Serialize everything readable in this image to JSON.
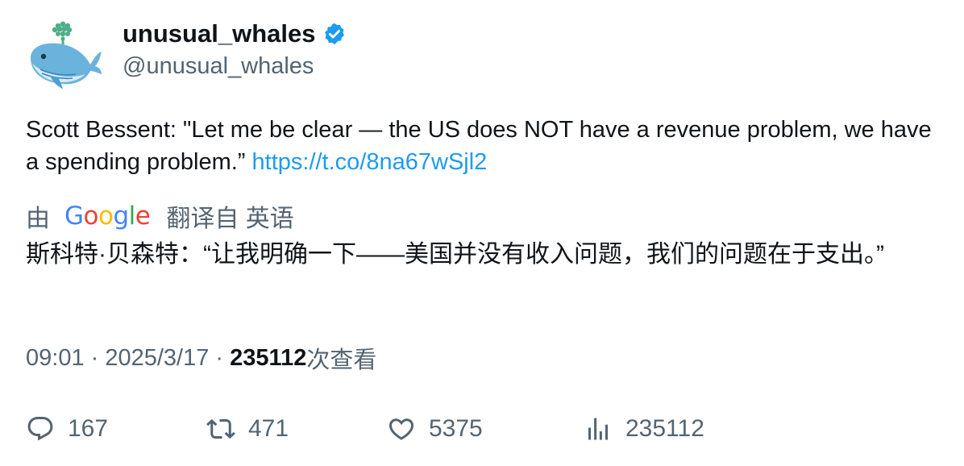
{
  "author": {
    "display_name": "unusual_whales",
    "handle": "@unusual_whales",
    "verified": true,
    "avatar_icon": "whale-logo-icon",
    "verified_icon": "verified-badge-icon"
  },
  "tweet": {
    "text": "Scott Bessent: \"Let me be clear — the US does NOT have a revenue problem, we have a spending problem.”",
    "link": "https://t.co/8na67wSjl2"
  },
  "translation": {
    "prefix": "由",
    "provider": "Google",
    "label": "翻译自 英语",
    "text": "斯科特·贝森特：“让我明确一下——美国并没有收入问题，我们的问题在于支出。”"
  },
  "meta": {
    "time": "09:01",
    "date": "2025/3/17",
    "views_count": "235112",
    "views_label": "次查看"
  },
  "actions": {
    "replies": "167",
    "retweets": "471",
    "likes": "5375",
    "views": "235112"
  },
  "colors": {
    "link": "#1d9bf0",
    "secondary_text": "#536471",
    "primary_text": "#0f1419",
    "verified": "#1d9bf0"
  }
}
